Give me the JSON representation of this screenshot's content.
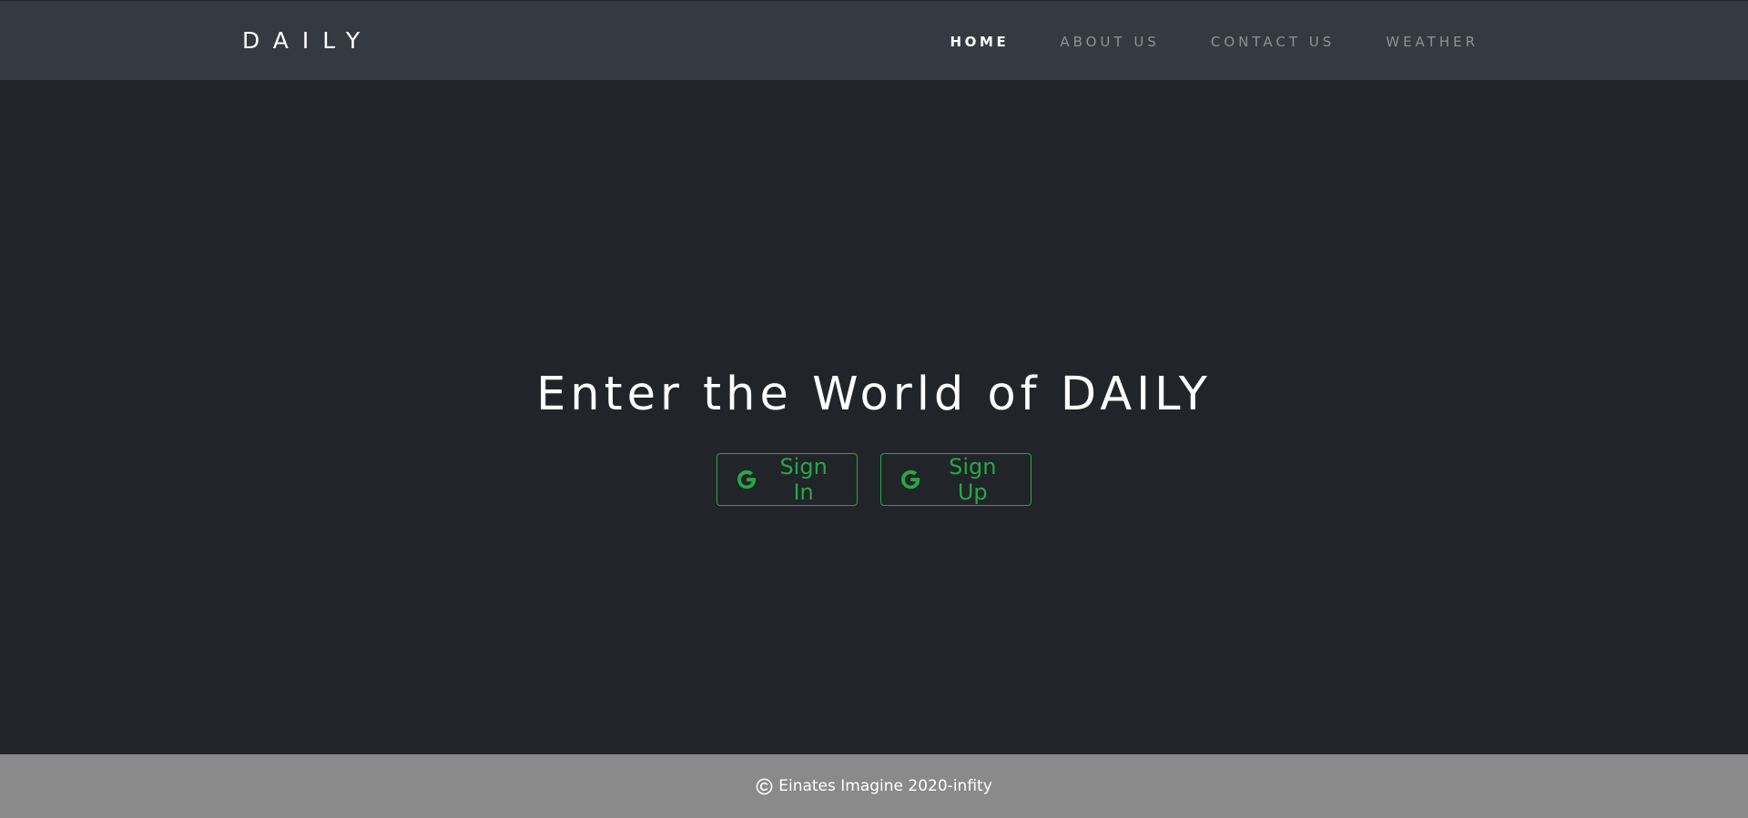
{
  "navbar": {
    "brand": "DAILY",
    "links": [
      {
        "label": "HOME",
        "active": true
      },
      {
        "label": "ABOUT US",
        "active": false
      },
      {
        "label": "CONTACT US",
        "active": false
      },
      {
        "label": "WEATHER",
        "active": false
      }
    ]
  },
  "hero": {
    "title": "Enter the World of DAILY",
    "buttons": {
      "sign_in": {
        "label": "Sign In",
        "icon": "google-icon"
      },
      "sign_up": {
        "label": "Sign Up",
        "icon": "google-icon"
      }
    }
  },
  "footer": {
    "icon": "copyright-icon",
    "text": "Einates Imagine 2020-infity"
  },
  "colors": {
    "navbar_bg": "#353a42",
    "page_bg": "#212428",
    "accent_green": "#28a745",
    "footer_bg": "#8a8a8a",
    "nav_inactive": "#8d9197"
  }
}
